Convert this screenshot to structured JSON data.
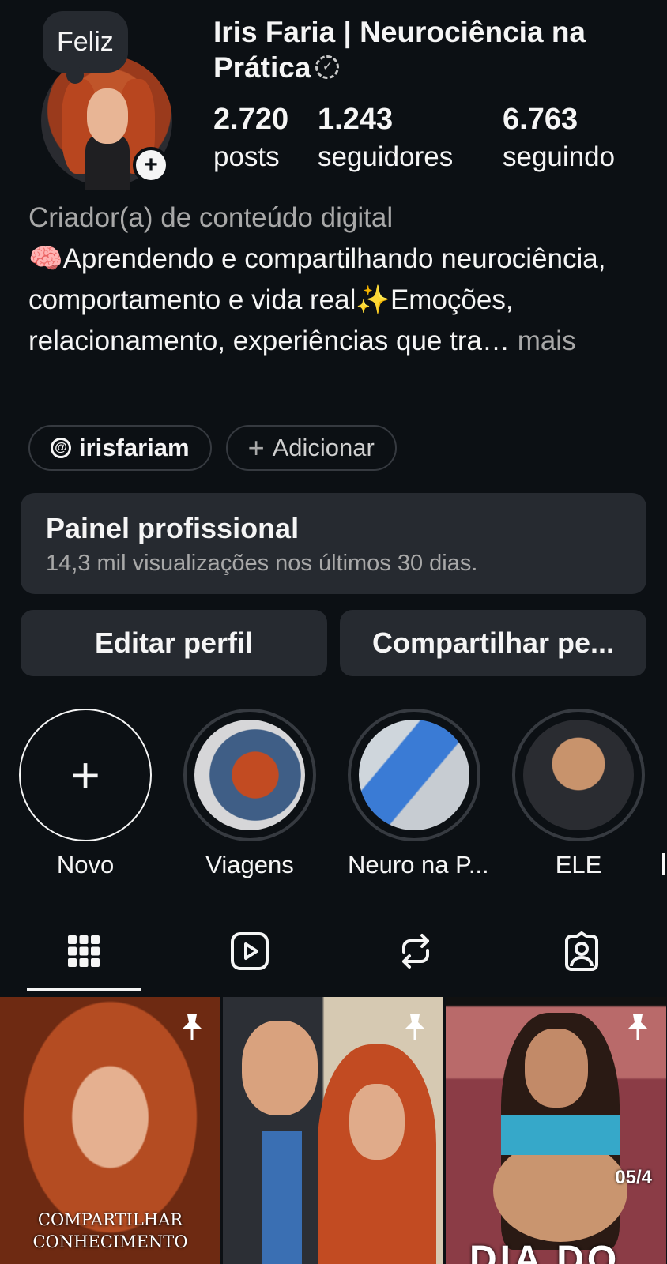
{
  "profile": {
    "note": "Feliz",
    "name": "Iris Faria | Neurociência na Prática",
    "stats": [
      {
        "value": "2.720",
        "label": "posts"
      },
      {
        "value": "1.243",
        "label": "seguidores"
      },
      {
        "value": "6.763",
        "label": "seguindo"
      }
    ],
    "category": "Criador(a) de conteúdo digital",
    "bio": "🧠Aprendendo e compartilhando neurociência, comportamento e vida real✨Emoções, relacionamento, experiências que tra…",
    "bio_more": "mais"
  },
  "links": {
    "threads_handle": "irisfariam",
    "add_label": "Adicionar"
  },
  "dashboard": {
    "title": "Painel profissional",
    "subtitle": "14,3 mil visualizações nos últimos 30 dias."
  },
  "actions": {
    "edit_label": "Editar perfil",
    "share_label": "Compartilhar pe..."
  },
  "highlights": [
    {
      "label": "Novo"
    },
    {
      "label": "Viagens"
    },
    {
      "label": "Neuro na P..."
    },
    {
      "label": "ELE"
    }
  ],
  "tabs": {
    "icons": [
      "grid-icon",
      "reels-icon",
      "reposts-icon",
      "tagged-icon"
    ],
    "active": "grid-icon"
  },
  "posts": [
    {
      "caption_line1": "COMPARTILHAR",
      "caption_line2": "CONHECIMENTO",
      "pinned": true
    },
    {
      "pinned": true
    },
    {
      "overlay_number": "05/4",
      "overlay_text": "DIA DO",
      "pinned": true
    }
  ],
  "colors": {
    "background": "#0c1014",
    "surface": "#262a30",
    "text_primary": "#f5f5f5",
    "text_secondary": "#a8a8a8"
  }
}
